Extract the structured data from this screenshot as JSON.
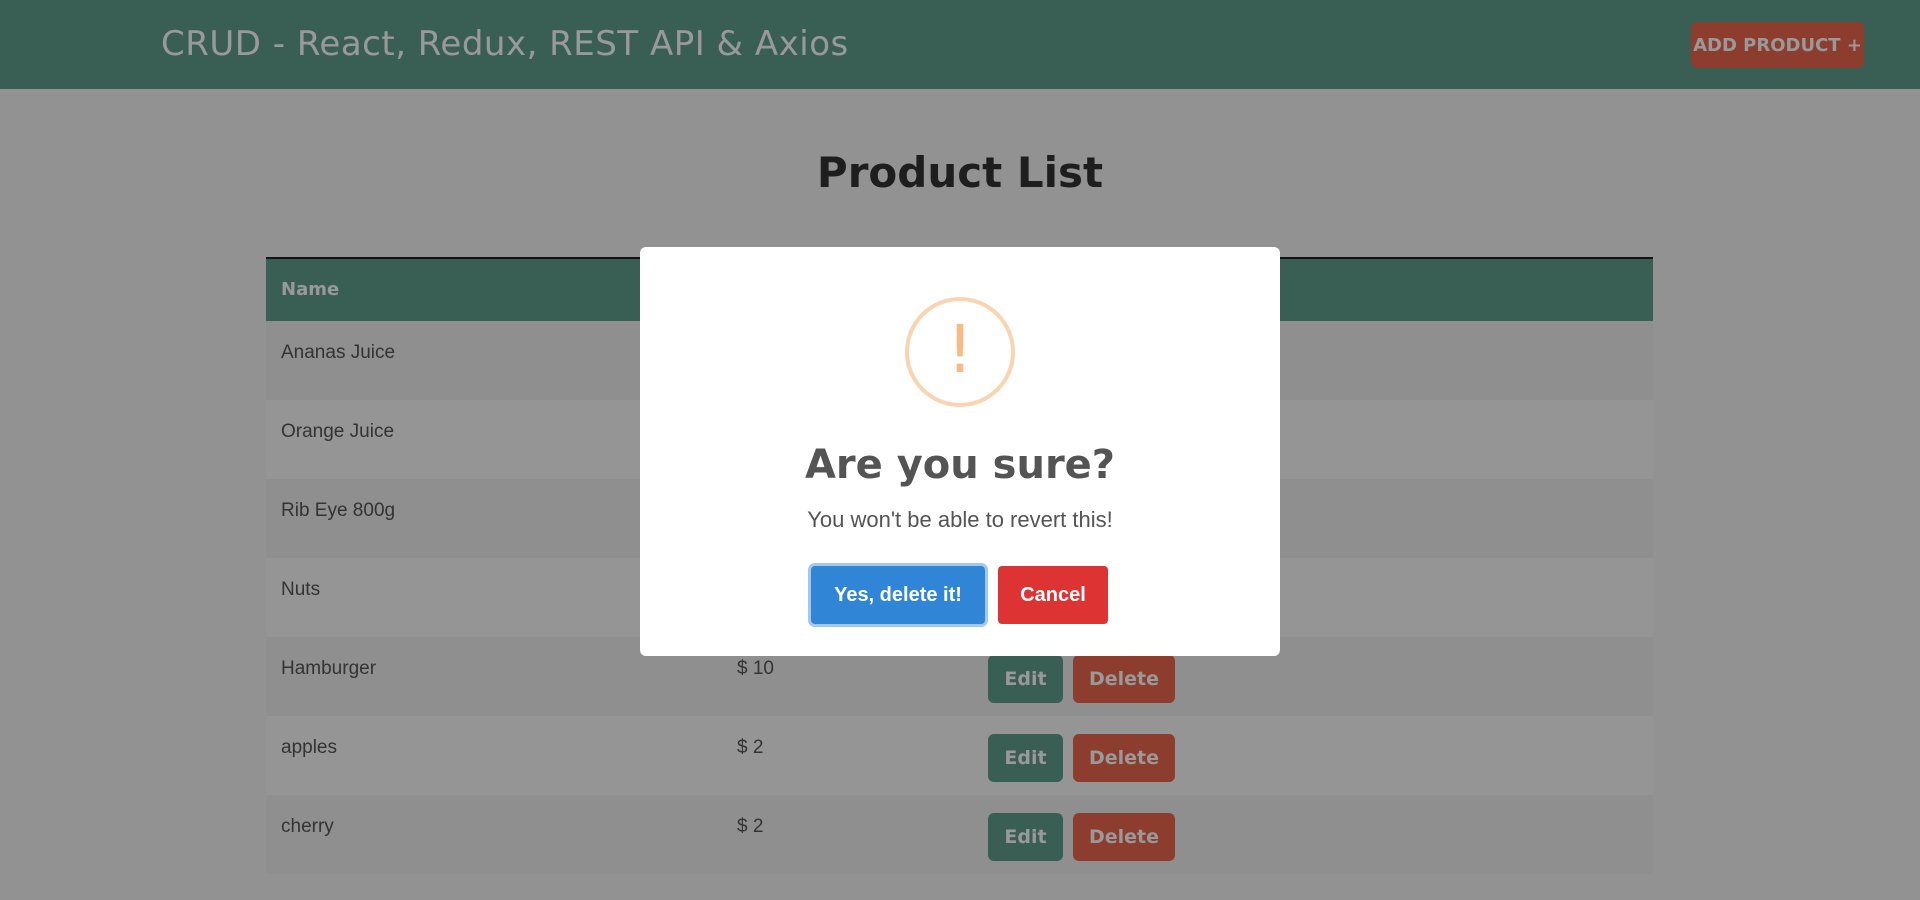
{
  "navbar": {
    "brand": "CRUD - React, Redux, REST API & Axios",
    "add_button": "ADD PRODUCT +",
    "bg_color": "#5f9e8d",
    "accent_color": "#e9674e"
  },
  "page": {
    "title": "Product List"
  },
  "table": {
    "headers": [
      "Name"
    ],
    "rows": [
      {
        "name": "Ananas Juice",
        "price": "",
        "edit": "",
        "delete": ""
      },
      {
        "name": "Orange Juice",
        "price": "",
        "edit": "",
        "delete": ""
      },
      {
        "name": "Rib Eye 800g",
        "price": "",
        "edit": "",
        "delete": ""
      },
      {
        "name": "Nuts",
        "price": "",
        "edit": "",
        "delete": ""
      },
      {
        "name": "Hamburger",
        "price": "$ 10",
        "edit": "Edit",
        "delete": "Delete"
      },
      {
        "name": "apples",
        "price": "$ 2",
        "edit": "Edit",
        "delete": "Delete"
      },
      {
        "name": "cherry",
        "price": "$ 2",
        "edit": "Edit",
        "delete": "Delete"
      }
    ]
  },
  "modal": {
    "icon": "warning-icon",
    "icon_glyph": "!",
    "title": "Are you sure?",
    "text": "You won't be able to revert this!",
    "confirm_label": "Yes, delete it!",
    "cancel_label": "Cancel",
    "confirm_color": "#3085d6",
    "cancel_color": "#dd3333"
  }
}
